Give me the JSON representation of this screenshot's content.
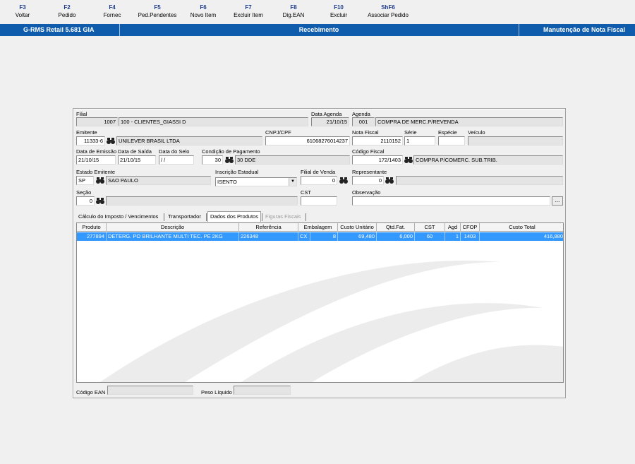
{
  "toolbar": {
    "keys": [
      {
        "key": "F3",
        "label": "Voltar"
      },
      {
        "key": "F2",
        "label": "Pedido"
      },
      {
        "key": "F4",
        "label": "Fornec"
      },
      {
        "key": "F5",
        "label": "Ped.Pendentes"
      },
      {
        "key": "F6",
        "label": "Novo Item"
      },
      {
        "key": "F7",
        "label": "Excluir Item"
      },
      {
        "key": "F8",
        "label": "Dig.EAN"
      },
      {
        "key": "F10",
        "label": "Excluir"
      },
      {
        "key": "ShF6",
        "label": "Associar Pedido"
      }
    ]
  },
  "titlebar": {
    "app": "G-RMS Retail 5.681 GIA",
    "module": "Recebimento",
    "screen": "Manutenção de Nota Fiscal",
    "color": "#0f5cac"
  },
  "form": {
    "filial": {
      "label": "Filial",
      "code": "1007",
      "name": "100 - CLIENTES_GIASSI D"
    },
    "data_agenda": {
      "label": "Data Agenda",
      "value": "21/10/15"
    },
    "agenda": {
      "label": "Agenda",
      "code": "001",
      "desc": "COMPRA DE MERC.P/REVENDA"
    },
    "emitente": {
      "label": "Emitente",
      "code": "11333-6",
      "name": "UNILEVER BRASIL LTDA"
    },
    "cnpj": {
      "label": "CNPJ/CPF",
      "value": "61068276014237"
    },
    "nota_fiscal": {
      "label": "Nota Fiscal",
      "value": "2110152"
    },
    "serie": {
      "label": "Série",
      "value": "1"
    },
    "especie": {
      "label": "Espécie",
      "value": ""
    },
    "veiculo": {
      "label": "Veículo",
      "value": ""
    },
    "data_emissao": {
      "label": "Data de Emissão",
      "value": "21/10/15"
    },
    "data_saida": {
      "label": "Data de Saída",
      "value": "21/10/15"
    },
    "data_selo": {
      "label": "Data do Selo",
      "value": " / /"
    },
    "cond_pagamento": {
      "label": "Condição de Pagamento",
      "code": "30",
      "desc": "30 DDE"
    },
    "codigo_fiscal": {
      "label": "Código Fiscal",
      "code": "172/1403",
      "desc": "COMPRA P/COMERC. SUB.TRIB."
    },
    "estado_emitente": {
      "label": "Estado Emitente",
      "code": "SP",
      "name": "SAO PAULO"
    },
    "inscricao_estadual": {
      "label": "Inscrição Estadual",
      "value": "ISENTO"
    },
    "filial_venda": {
      "label": "Filial de Venda",
      "value": "0"
    },
    "representante": {
      "label": "Representante",
      "code": "0",
      "name": ""
    },
    "secao": {
      "label": "Seção",
      "code": "0",
      "name": ""
    },
    "cst": {
      "label": "CST",
      "value": ""
    },
    "observacao": {
      "label": "Observação",
      "value": "",
      "button": "..."
    }
  },
  "tabs": [
    {
      "label": "Cálculo do Imposto / Vencimentos",
      "state": "normal"
    },
    {
      "label": "Transportador",
      "state": "normal"
    },
    {
      "label": "Dados dos Produtos",
      "state": "active"
    },
    {
      "label": "Figuras Fiscais",
      "state": "disabled"
    }
  ],
  "grid": {
    "columns": [
      "Produto",
      "Descrição",
      "Referência",
      "Embalagem",
      "Custo Unitário",
      "Qtd.Fat.",
      "CST",
      "Agd",
      "CFOP",
      "Custo Total"
    ],
    "rows": [
      [
        "277894",
        "DETERG. PO BRILHANTE MULTI TEC. PE  2KG",
        "226348",
        "CX",
        "8",
        "69,480",
        "6,000",
        "60",
        "1",
        "1403",
        "416,880"
      ]
    ],
    "selected_color": "#3399ff"
  },
  "footer": {
    "ean": {
      "label": "Código EAN",
      "value": ""
    },
    "peso": {
      "label": "Peso Líquido",
      "value": ""
    }
  }
}
